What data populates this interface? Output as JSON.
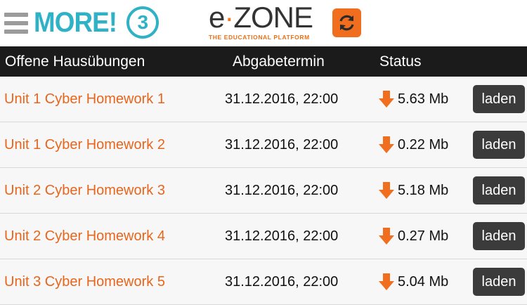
{
  "app": {
    "more_logo_text": "MORE!",
    "more_logo_number": "3",
    "ezone_logo_left": "e",
    "ezone_logo_right": "ZONE",
    "ezone_tagline": "THE EDUCATIONAL PLATFORM"
  },
  "icons": {
    "menu": "hamburger-menu-icon",
    "refresh": "refresh-icon",
    "download": "download-arrow-icon"
  },
  "colors": {
    "brand_cyan": "#2fb1c6",
    "accent_orange": "#f06e1e",
    "header_bg": "#1b1b1b",
    "button_bg": "#3b3b3b"
  },
  "table": {
    "headers": {
      "name": "Offene Hausübungen",
      "due": "Abgabetermin",
      "status": "Status"
    },
    "rows": [
      {
        "name": "Unit 1 Cyber Homework 1",
        "due": "31.12.2016, 22:00",
        "size": "5.63 Mb",
        "action": "laden"
      },
      {
        "name": "Unit 1 Cyber Homework 2",
        "due": "31.12.2016, 22:00",
        "size": "0.22 Mb",
        "action": "laden"
      },
      {
        "name": "Unit 2 Cyber Homework 3",
        "due": "31.12.2016, 22:00",
        "size": "5.18 Mb",
        "action": "laden"
      },
      {
        "name": "Unit 2 Cyber Homework 4",
        "due": "31.12.2016, 22:00",
        "size": "0.27 Mb",
        "action": "laden"
      },
      {
        "name": "Unit 3 Cyber Homework 5",
        "due": "31.12.2016, 22:00",
        "size": "5.04 Mb",
        "action": "laden"
      }
    ]
  }
}
